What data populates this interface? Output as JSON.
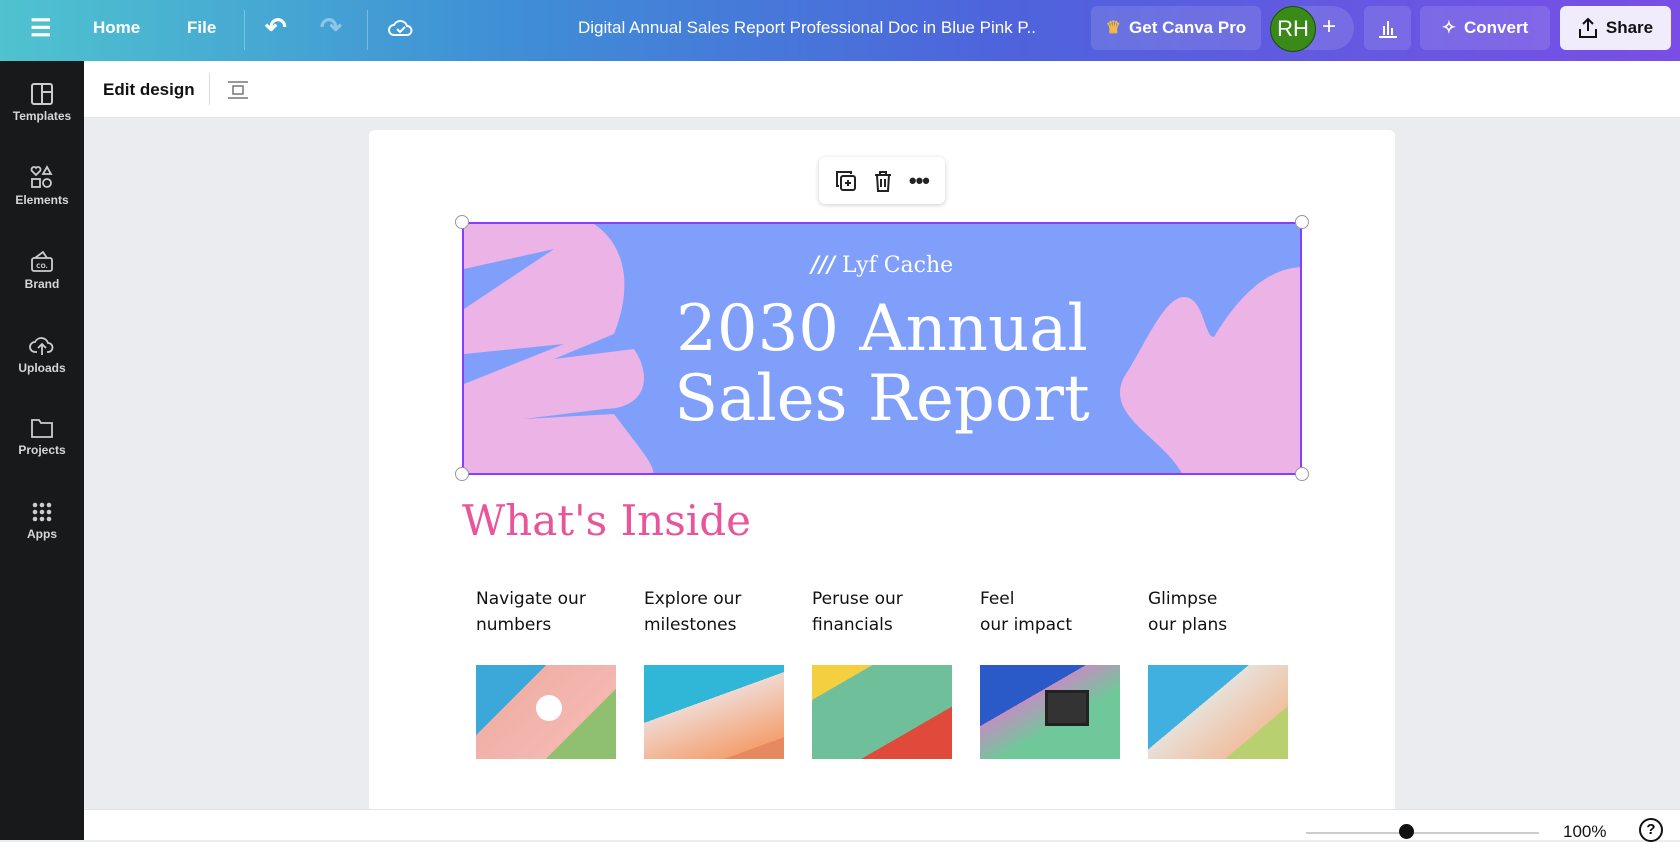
{
  "topbar": {
    "home": "Home",
    "file": "File",
    "title": "Digital Annual Sales Report Professional Doc in Blue Pink P..",
    "get_pro": "Get Canva Pro",
    "avatar": "RH",
    "convert": "Convert",
    "share": "Share"
  },
  "sidebar": {
    "items": [
      {
        "label": "Templates"
      },
      {
        "label": "Elements"
      },
      {
        "label": "Brand"
      },
      {
        "label": "Uploads"
      },
      {
        "label": "Projects"
      },
      {
        "label": "Apps"
      }
    ]
  },
  "editbar": {
    "edit_design": "Edit design"
  },
  "design": {
    "brand": "Lyf Cache",
    "title_line1": "2030 Annual",
    "title_line2": "Sales Report",
    "section_title": "What's Inside",
    "columns": [
      {
        "line1": "Navigate our",
        "line2": "numbers"
      },
      {
        "line1": "Explore our",
        "line2": "milestones"
      },
      {
        "line1": "Peruse our",
        "line2": "financials"
      },
      {
        "line1": "Feel",
        "line2": "our impact"
      },
      {
        "line1": "Glimpse",
        "line2": "our plans"
      }
    ]
  },
  "bottombar": {
    "zoom": "100%",
    "zoom_level": 0.43,
    "help": "?"
  },
  "colors": {
    "banner": "#7f9ffa",
    "pink": "#ecb3e6",
    "heading": "#e8559a",
    "avatar": "#3a8a1a"
  }
}
